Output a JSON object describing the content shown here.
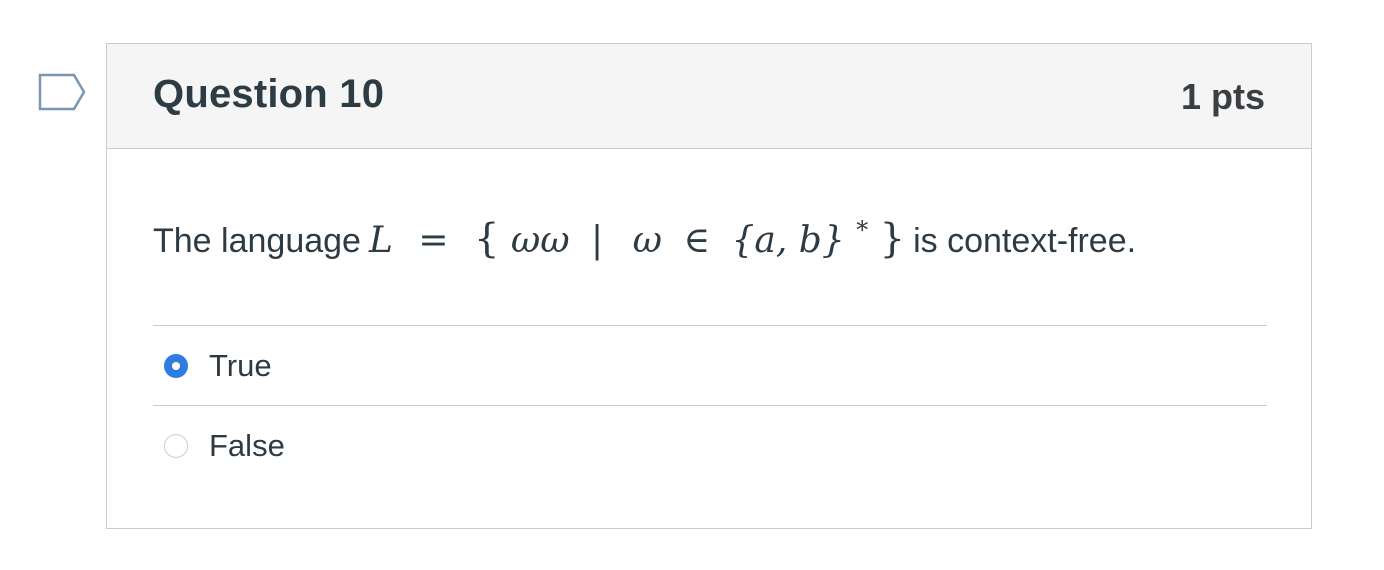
{
  "question": {
    "title": "Question 10",
    "points": "1 pts",
    "text_before": "The language",
    "math": {
      "L": "L",
      "equals": "=",
      "open_brace": "{",
      "ww": "ωω",
      "bar": "|",
      "w": "ω",
      "in": "∈",
      "set": "{a, b}",
      "star": "*",
      "close_brace": "}"
    },
    "text_after": "is context-free."
  },
  "answers": [
    {
      "label": "True",
      "selected": true
    },
    {
      "label": "False",
      "selected": false
    }
  ],
  "colors": {
    "accent": "#2f7de1",
    "header_bg": "#f5f5f5",
    "border": "#c7cdd1",
    "text": "#2d3b45",
    "flag": "#7b96b0"
  },
  "icons": {
    "flag": "bookmark-flag-icon"
  }
}
